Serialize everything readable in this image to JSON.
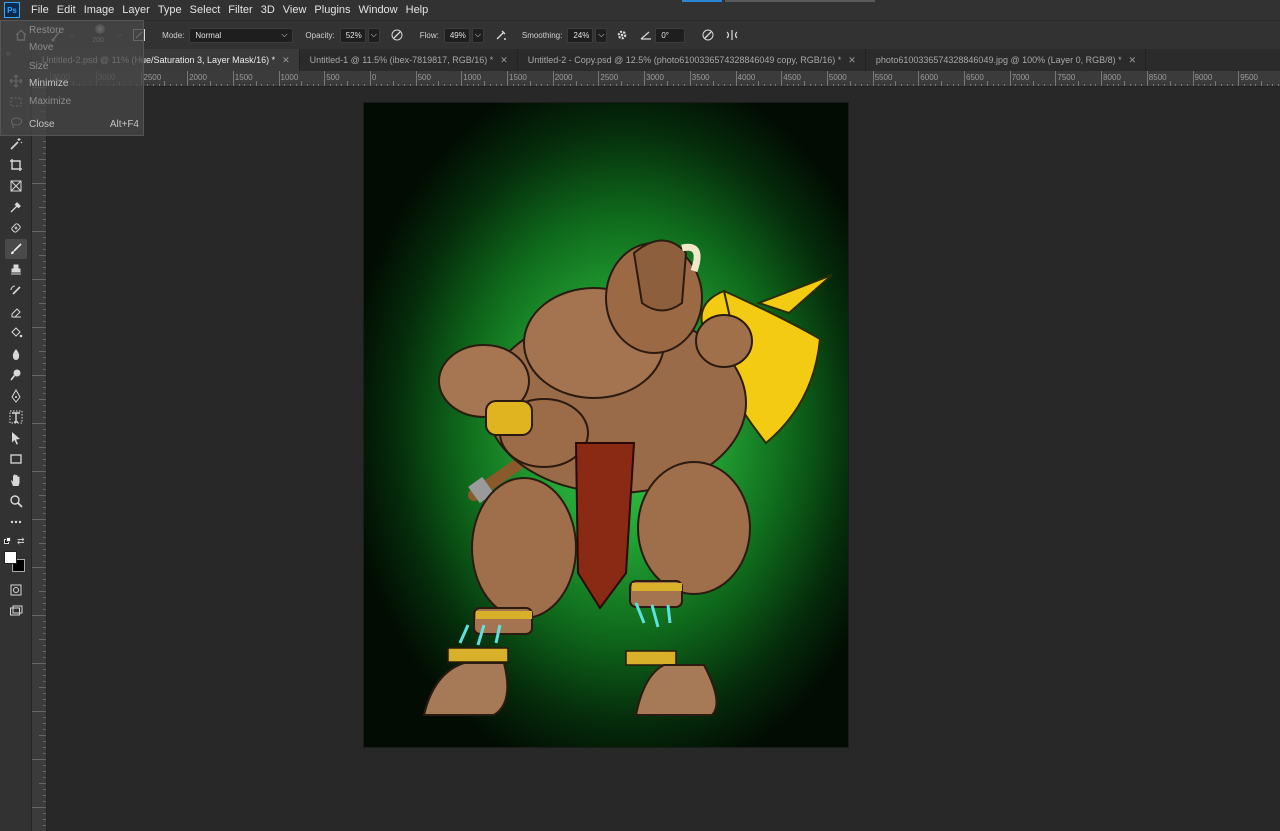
{
  "app": {
    "logo": "Ps"
  },
  "menu": [
    "File",
    "Edit",
    "Image",
    "Layer",
    "Type",
    "Select",
    "Filter",
    "3D",
    "View",
    "Plugins",
    "Window",
    "Help"
  ],
  "system_menu": {
    "items": [
      {
        "label": "Restore",
        "enabled": false
      },
      {
        "label": "Move",
        "enabled": false
      },
      {
        "label": "Size",
        "enabled": false
      },
      {
        "label": "Minimize",
        "enabled": true
      },
      {
        "label": "Maximize",
        "enabled": false
      },
      {
        "label": "Close",
        "enabled": true,
        "shortcut": "Alt+F4"
      }
    ]
  },
  "options": {
    "brush_size": "200",
    "mode_label": "Mode:",
    "mode_value": "Normal",
    "opacity_label": "Opacity:",
    "opacity_value": "52%",
    "flow_label": "Flow:",
    "flow_value": "49%",
    "smoothing_label": "Smoothing:",
    "smoothing_value": "24%",
    "angle_value": "0°"
  },
  "tabs": [
    {
      "label": "Untitled-2.psd @ 11% (Hue/Saturation 3, Layer Mask/16) *",
      "active": true
    },
    {
      "label": "Untitled-1 @ 11.5% (ibex-7819817, RGB/16) *",
      "active": false
    },
    {
      "label": "Untitled-2 - Copy.psd @ 12.5% (photo6100336574328846049 copy, RGB/16) *",
      "active": false
    },
    {
      "label": "photo6100336574328846049.jpg @ 100% (Layer 0, RGB/8) *",
      "active": false
    }
  ],
  "ruler": {
    "top_labels": [
      "3500",
      "3000",
      "2500",
      "2000",
      "1500",
      "1000",
      "500",
      "0",
      "500",
      "1000",
      "1500",
      "2000",
      "2500",
      "3000",
      "3500",
      "4000",
      "4500",
      "5000",
      "5500",
      "6000",
      "6500",
      "7000",
      "7500",
      "8000",
      "8500",
      "9000",
      "9500",
      "1000"
    ]
  },
  "tools": [
    "move-icon",
    "marquee-icon",
    "lasso-icon",
    "magic-wand-icon",
    "crop-icon",
    "frame-icon",
    "eyedropper-icon",
    "healing-brush-icon",
    "brush-icon",
    "stamp-icon",
    "history-brush-icon",
    "eraser-icon",
    "paint-bucket-icon",
    "blur-icon",
    "dodge-icon",
    "pen-icon",
    "type-icon",
    "path-select-icon",
    "rectangle-icon",
    "hand-icon",
    "zoom-icon",
    "more-tools-icon"
  ],
  "colors": {
    "foreground": "#ffffff",
    "background": "#000000",
    "accent": "#31a8ff"
  }
}
